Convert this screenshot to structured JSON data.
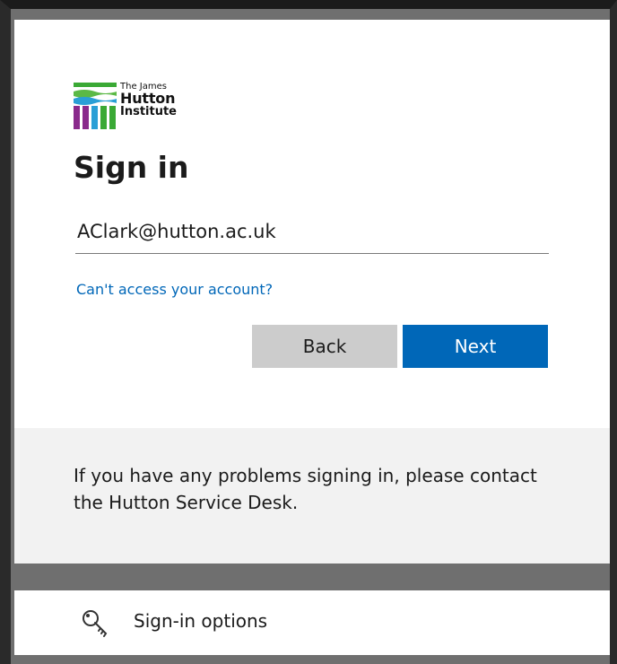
{
  "logo": {
    "line1": "The James",
    "line2": "Hutton",
    "line3": "Institute",
    "icon": "james-hutton-logo",
    "colors": [
      "#3aa935",
      "#2a9fd6",
      "#8a2a8c"
    ]
  },
  "title": "Sign in",
  "email_input": {
    "value": "AClark@hutton.ac.uk"
  },
  "cant_access_link": "Can't access your account?",
  "buttons": {
    "back": "Back",
    "next": "Next"
  },
  "footer": {
    "text": "If you have any problems signing in, please contact the Hutton Service Desk."
  },
  "sign_in_options": {
    "label": "Sign-in options",
    "icon": "key-icon"
  },
  "colors": {
    "accent": "#0067b8",
    "back_button": "#cccccc",
    "footer_bg": "#f2f2f2"
  }
}
